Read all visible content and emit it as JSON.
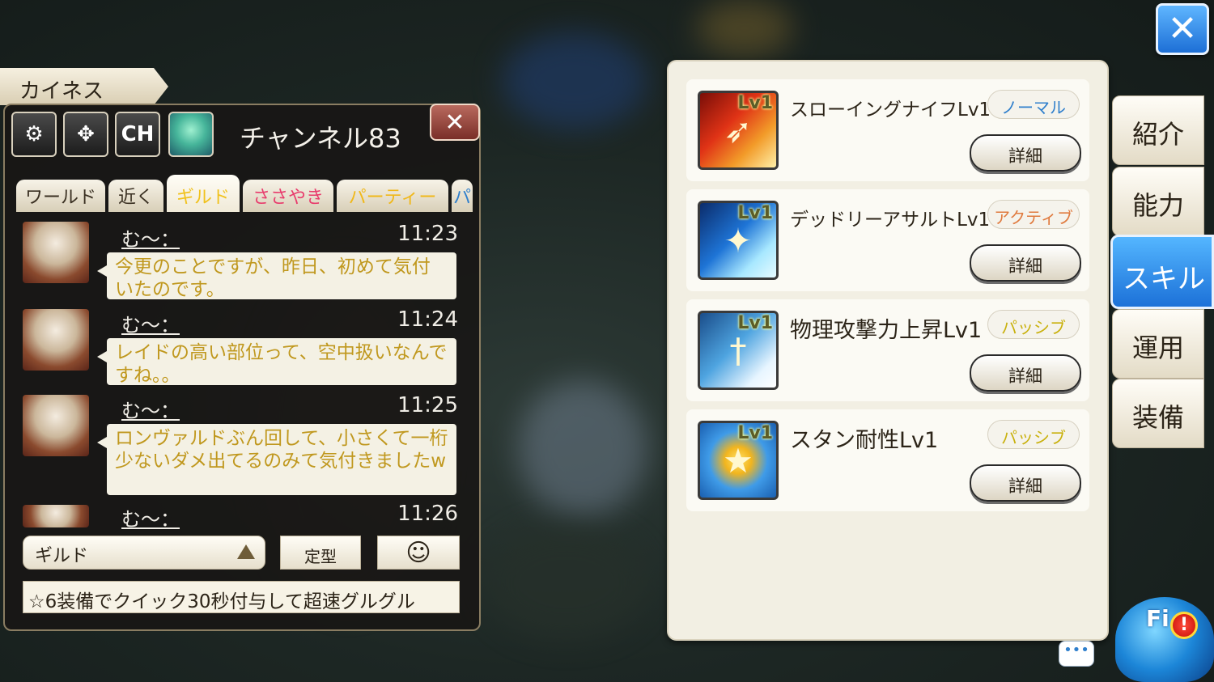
{
  "player_name_tab": "カイネス",
  "chat": {
    "toolbar": {
      "settings_icon": "gear-icon",
      "move_icon": "move-arrows-icon",
      "channel_button_label": "CH",
      "channel_title": "チャンネル83",
      "close_glyph": "✕"
    },
    "tabs": [
      {
        "label": "ワールド",
        "color": "#3a3022"
      },
      {
        "label": "近く",
        "color": "#3a3022"
      },
      {
        "label": "ギルド",
        "color": "#f1c21e",
        "active": true
      },
      {
        "label": "ささやき",
        "color": "#e83b6c"
      },
      {
        "label": "パーティー",
        "color": "#f0b81a"
      },
      {
        "label": "パ",
        "color": "#2f7fcc"
      }
    ],
    "messages": [
      {
        "name": "む～：",
        "time": "11:23",
        "text": "今更のことですが、昨日、初めて気付いたのです。"
      },
      {
        "name": "む～：",
        "time": "11:24",
        "text": "レイドの高い部位って、空中扱いなんですね。。"
      },
      {
        "name": "む～：",
        "time": "11:25",
        "text": "ロンヴァルドぶん回して、小さくて一桁少ないダメ出てるのみて気付きましたw"
      },
      {
        "name": "む～：",
        "time": "11:26",
        "text": ""
      }
    ],
    "channel_select": "ギルド",
    "template_button": "定型",
    "emoji_glyph": "☺",
    "input_value": "☆6装備でクイック30秒付与して超速グルグル"
  },
  "skills": [
    {
      "level_badge": "Lv1",
      "name": "スローイングナイフLv1",
      "type": "ノーマル",
      "detail": "詳細",
      "icon": "throwing-knife-icon"
    },
    {
      "level_badge": "Lv1",
      "name": "デッドリーアサルトLv1",
      "type": "アクティブ",
      "detail": "詳細",
      "icon": "deadly-assault-icon"
    },
    {
      "level_badge": "Lv1",
      "name": "物理攻撃力上昇Lv1",
      "type": "パッシブ",
      "detail": "詳細",
      "icon": "sword-buff-icon"
    },
    {
      "level_badge": "Lv1",
      "name": "スタン耐性Lv1",
      "type": "パッシブ",
      "detail": "詳細",
      "icon": "stun-stars-icon"
    }
  ],
  "side_tabs": [
    "紹介",
    "能力",
    "スキル",
    "運用",
    "装備"
  ],
  "active_side_tab": "スキル",
  "mascot": {
    "label": "Fi",
    "alert": "!"
  },
  "speech_glyph": "•••",
  "colors": {
    "accent_blue": "#1c71d8",
    "type_normal": "#2f7fcc",
    "type_active": "#e07a3e",
    "type_passive": "#c9b10d",
    "bubble_text": "#c0981e"
  }
}
